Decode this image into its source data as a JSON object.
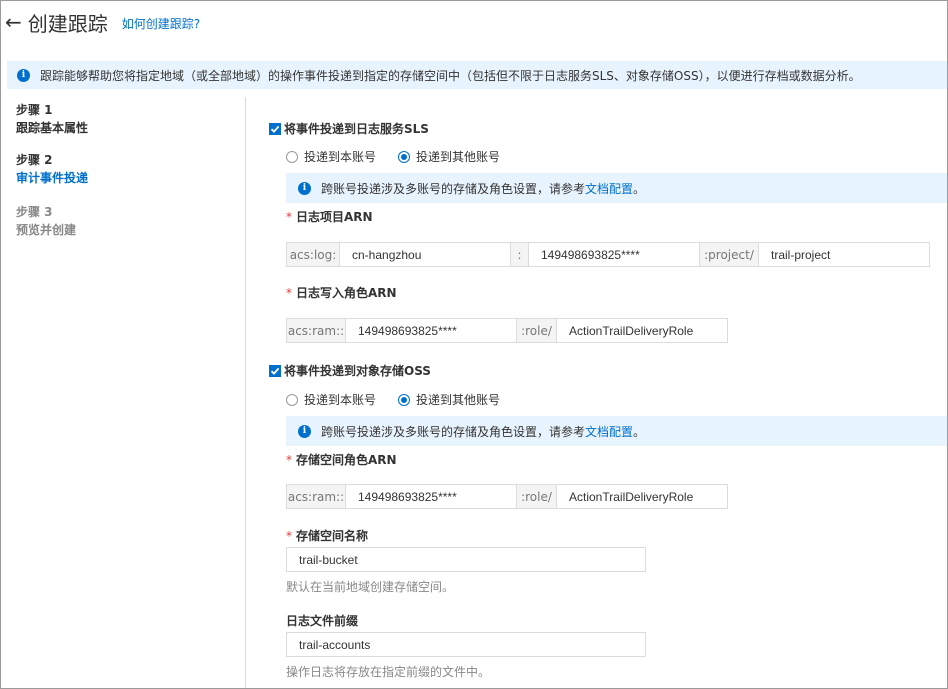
{
  "header": {
    "back_symbol": "←",
    "title": "创建跟踪",
    "help_link": "如何创建跟踪?"
  },
  "info_bar": {
    "icon": "info-icon",
    "text": "跟踪能够帮助您将指定地域（或全部地域）的操作事件投递到指定的存储空间中（包括但不限于日志服务SLS、对象存储OSS），以便进行存档或数据分析。"
  },
  "steps": [
    {
      "num": "步骤 1",
      "name": "跟踪基本属性",
      "state": "done"
    },
    {
      "num": "步骤 2",
      "name": "审计事件投递",
      "state": "active"
    },
    {
      "num": "步骤 3",
      "name": "预览并创建",
      "state": "pending"
    }
  ],
  "sls": {
    "checkbox_label": "将事件投递到日志服务SLS",
    "checked": true,
    "radio_self": "投递到本账号",
    "radio_other": "投递到其他账号",
    "selected": "other",
    "notice_text": "跨账号投递涉及多账号的存储及角色设置，请参考",
    "notice_link": "文档配置",
    "notice_end": "。",
    "project_arn_label": "日志项目ARN",
    "project_arn": {
      "prefix": "acs:log:",
      "region": "cn-hangzhou",
      "sep": ":",
      "account": "149498693825****",
      "project_prefix": ":project/",
      "project": "trail-project"
    },
    "role_arn_label": "日志写入角色ARN",
    "role_arn": {
      "prefix": "acs:ram::",
      "account": "149498693825****",
      "role_prefix": ":role/",
      "role": "ActionTrailDeliveryRole"
    }
  },
  "oss": {
    "checkbox_label": "将事件投递到对象存储OSS",
    "checked": true,
    "radio_self": "投递到本账号",
    "radio_other": "投递到其他账号",
    "selected": "other",
    "notice_text": "跨账号投递涉及多账号的存储及角色设置，请参考",
    "notice_link": "文档配置",
    "notice_end": "。",
    "role_arn_label": "存储空间角色ARN",
    "role_arn": {
      "prefix": "acs:ram::",
      "account": "149498693825****",
      "role_prefix": ":role/",
      "role": "ActionTrailDeliveryRole"
    },
    "bucket_label": "存储空间名称",
    "bucket_value": "trail-bucket",
    "bucket_hint": "默认在当前地域创建存储空间。",
    "prefix_label": "日志文件前缀",
    "prefix_value": "trail-accounts",
    "prefix_hint": "操作日志将存放在指定前缀的文件中。"
  },
  "required_mark": "*",
  "colors": {
    "accent": "#0070cc",
    "info_bg": "#e8f4fd",
    "required": "#e4393c"
  }
}
